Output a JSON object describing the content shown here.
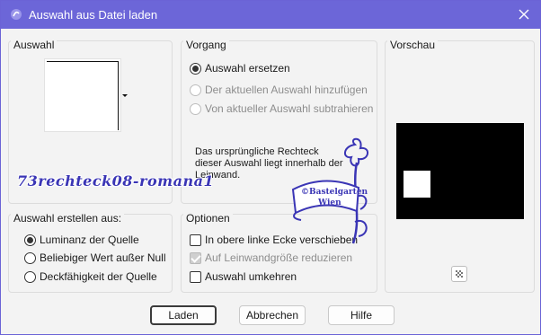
{
  "window": {
    "title": "Auswahl aus Datei laden"
  },
  "auswahl": {
    "label": "Auswahl",
    "dropdown_icon": "triangle-down-icon"
  },
  "vorgang": {
    "label": "Vorgang",
    "options": [
      {
        "label": "Auswahl ersetzen",
        "checked": true,
        "enabled": true
      },
      {
        "label": "Der aktuellen Auswahl hinzufügen",
        "checked": false,
        "enabled": false
      },
      {
        "label": "Von aktueller Auswahl subtrahieren",
        "checked": false,
        "enabled": false
      }
    ],
    "info": "Das ursprüngliche Rechteck dieser Auswahl liegt innerhalb der Leinwand."
  },
  "vorschau": {
    "label": "Vorschau",
    "toggle_icon": "checkerboard-icon"
  },
  "erstellen": {
    "label": "Auswahl erstellen aus:",
    "options": [
      {
        "label": "Luminanz der Quelle",
        "checked": true
      },
      {
        "label": "Beliebiger Wert außer Null",
        "checked": false
      },
      {
        "label": "Deckfähigkeit der Quelle",
        "checked": false
      }
    ]
  },
  "optionen": {
    "label": "Optionen",
    "items": [
      {
        "label": "In obere linke Ecke verschieben",
        "checked": false,
        "enabled": true
      },
      {
        "label": "Auf Leinwandgröße reduzieren",
        "checked": true,
        "enabled": false
      },
      {
        "label": "Auswahl umkehren",
        "checked": false,
        "enabled": true
      }
    ]
  },
  "buttons": {
    "laden": "Laden",
    "abbrechen": "Abbrechen",
    "hilfe": "Hilfe"
  },
  "watermark": {
    "text": "73rechteck08-romana1",
    "logo_text_1": "©Bastelgarten",
    "logo_text_2": "Wien"
  },
  "colors": {
    "titlebar": "#6c66d8",
    "watermark": "#3a35b5"
  }
}
